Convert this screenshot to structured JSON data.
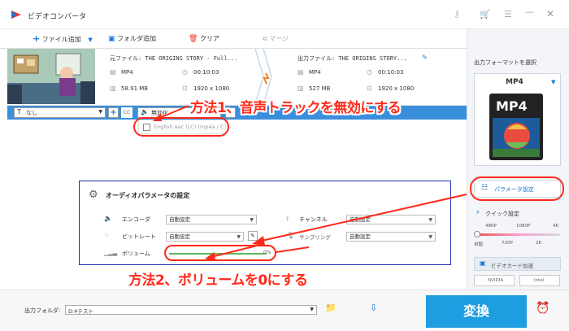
{
  "window": {
    "title": "ビデオコンバータ"
  },
  "toolbar": {
    "add_file": "ファイル追加",
    "add_folder": "フォルダ追加",
    "clear": "クリア",
    "merge": "マージ"
  },
  "source": {
    "filename": "元ファイル: THE ORIGINS STORY - Full...",
    "format": "MP4",
    "duration": "00:10:03",
    "size": "58.91 MB",
    "resolution": "1920 x 1080"
  },
  "output": {
    "filename": "出力ファイル: THE ORIGINS STORY...",
    "format": "MP4",
    "duration": "00:10:03",
    "size": "527 MB",
    "resolution": "1920 x 1080"
  },
  "subtitle": {
    "value": "なし"
  },
  "audio": {
    "toggle_label": "無効化",
    "track": "English aac (LC) (mp4a / C"
  },
  "audio_params": {
    "title": "オーディオパラメータの設定",
    "encoder_label": "エンコーダ",
    "encoder_value": "自動設定",
    "bitrate_label": "ビットレート",
    "bitrate_value": "自動設定",
    "volume_label": "ボリューム",
    "volume_value": "0%",
    "volume_level": 0,
    "channel_label": "チャンネル",
    "channel_value": "自動設定",
    "samplerate_label": "サンプリング",
    "samplerate_value": "自動設定"
  },
  "right": {
    "format_select_label": "出力フォーマットを選択",
    "format": "MP4",
    "format_icon_text": "MP4",
    "param_button": "パラメータ設定",
    "quick_label": "クイック設定",
    "quick_top": [
      "480P",
      "1080P",
      "4K"
    ],
    "quick_bottom": [
      "自動",
      "720P",
      "2K"
    ],
    "gpu_label": "ビデオカード加速",
    "nvidia": "NVIDIA",
    "intel": "Intel"
  },
  "bottom": {
    "output_folder_label": "出力フォルダ:",
    "output_folder_value": "D:¥テスト",
    "convert": "変換"
  },
  "annotations": {
    "method1": "方法1、音声トラックを無効にする",
    "method2": "方法2、ボリュームを0にする"
  },
  "colors": {
    "accent": "#1e9de0",
    "annotation": "#ff2a1a",
    "panel_border": "#1a2eb8"
  }
}
